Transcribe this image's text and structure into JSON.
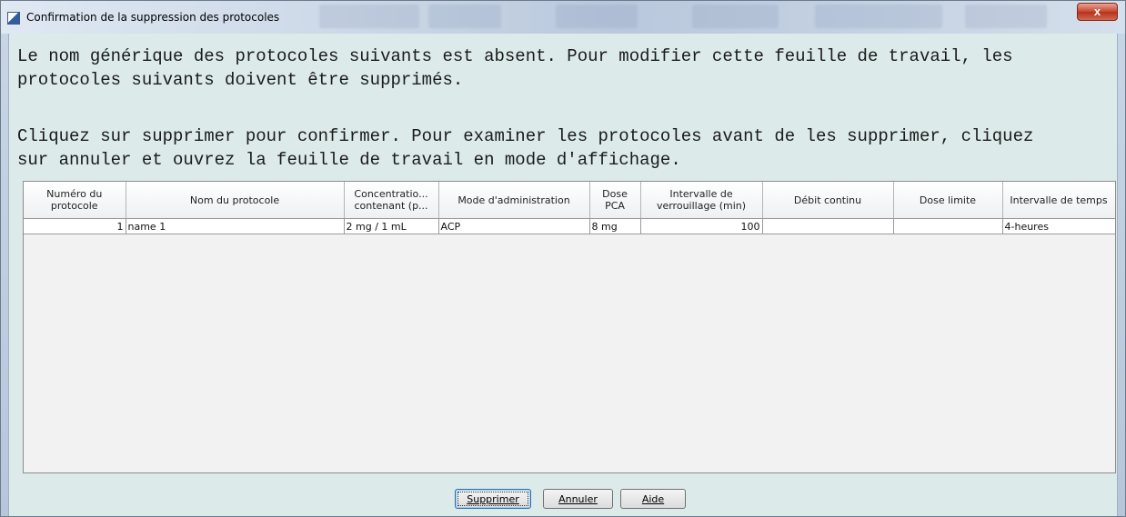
{
  "window": {
    "title": "Confirmation de la suppression des protocoles",
    "close_label": "x"
  },
  "message": {
    "paragraph1": "Le nom générique des protocoles suivants est absent. Pour modifier cette feuille de travail, les\nprotocoles suivants doivent être supprimés.",
    "paragraph2": "Cliquez sur supprimer pour confirmer. Pour examiner les protocoles avant de les supprimer, cliquez\nsur annuler et ouvrez la feuille de travail en mode d'affichage."
  },
  "table": {
    "columns": [
      "Numéro du protocole",
      "Nom du protocole",
      "Concentratio... contenant (p...",
      "Mode d'administration",
      "Dose PCA",
      "Intervalle de verrouillage (min)",
      "Débit continu",
      "Dose limite",
      "Intervalle de temps"
    ],
    "rows": [
      [
        "1",
        "name 1",
        "2 mg / 1 mL",
        "ACP",
        "8 mg",
        "100",
        "",
        "",
        "4-heures"
      ]
    ]
  },
  "buttons": {
    "delete": "Supprimer",
    "cancel": "Annuler",
    "help": "Aide"
  }
}
